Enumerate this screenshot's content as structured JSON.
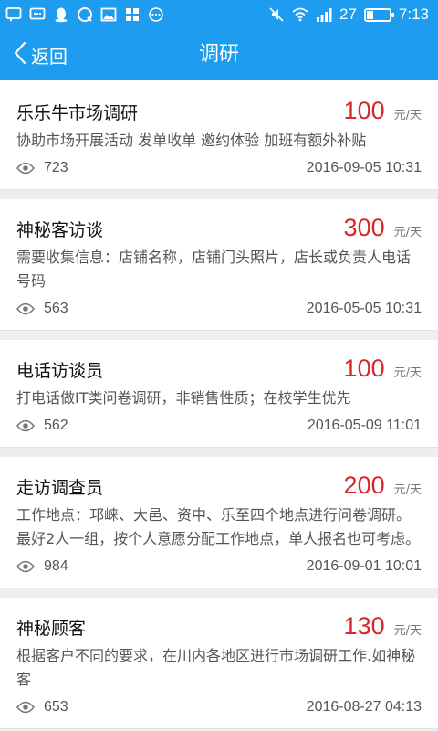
{
  "status_bar": {
    "left_icons": [
      "chat-icon",
      "message-icon",
      "penguin-icon",
      "browser-icon",
      "image-icon",
      "grid-icon",
      "more-icon"
    ],
    "right_icons": [
      "mute-icon",
      "wifi-icon",
      "signal-icon"
    ],
    "battery_level": "27",
    "time": "7:13"
  },
  "nav": {
    "back_label": "返回",
    "title": "调研"
  },
  "jobs": [
    {
      "title": "乐乐牛市场调研",
      "price": "100",
      "unit": "元/天",
      "desc": "协助市场开展活动 发单收单 邀约体验 加班有额外补贴",
      "views": "723",
      "date": "2016-09-05 10:31"
    },
    {
      "title": "神秘客访谈",
      "price": "300",
      "unit": "元/天",
      "desc": "需要收集信息：店铺名称，店铺门头照片，店长或负责人电话号码",
      "views": "563",
      "date": "2016-05-05 10:31"
    },
    {
      "title": "电话访谈员",
      "price": "100",
      "unit": "元/天",
      "desc": "打电话做IT类问卷调研，非销售性质；在校学生优先",
      "views": "562",
      "date": "2016-05-09 11:01"
    },
    {
      "title": "走访调查员",
      "price": "200",
      "unit": "元/天",
      "desc": "工作地点：邛崃、大邑、资中、乐至四个地点进行问卷调研。最好2人一组，按个人意愿分配工作地点，单人报名也可考虑。",
      "views": "984",
      "date": "2016-09-01 10:01"
    },
    {
      "title": "神秘顾客",
      "price": "130",
      "unit": "元/天",
      "desc": "根据客户不同的要求，在川内各地区进行市场调研工作.如神秘客",
      "views": "653",
      "date": "2016-08-27 04:13"
    }
  ]
}
